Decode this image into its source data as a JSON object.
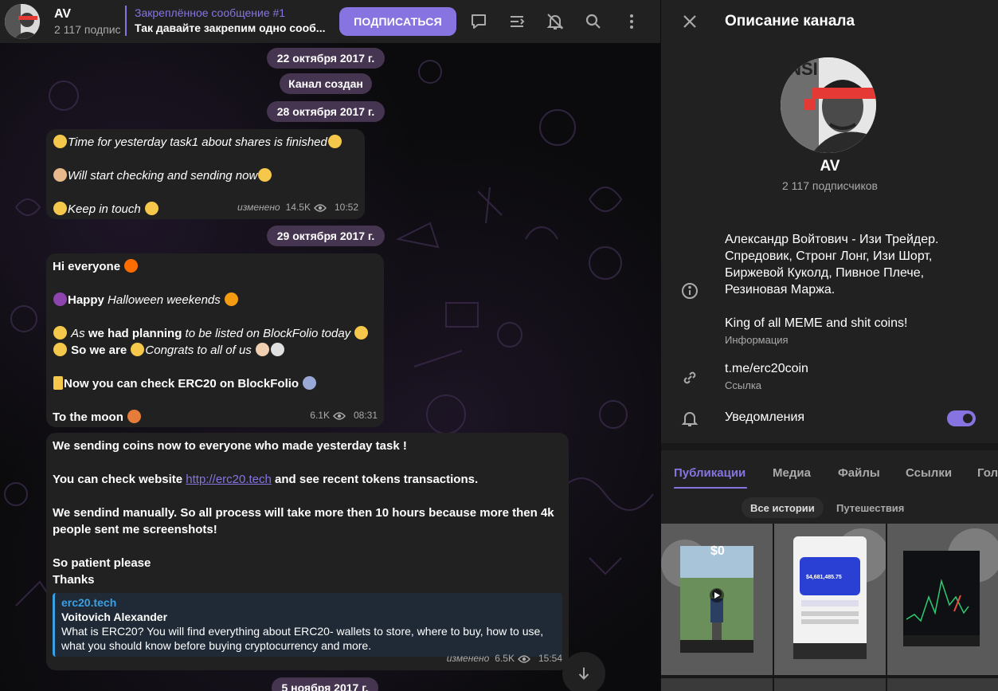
{
  "header": {
    "title": "AV",
    "subtitle": "2 117 подпис",
    "pinned_title": "Закреплённое сообщение #1",
    "pinned_text": "Так давайте закрепим одно сооб...",
    "subscribe_label": "ПОДПИСАТЬСЯ"
  },
  "chat": {
    "dates": [
      "22 октября 2017 г.",
      "28 октября 2017 г.",
      "29 октября 2017 г.",
      "5 ноября 2017 г."
    ],
    "service": "Канал создан",
    "msg1": {
      "line1": "Time for yesterday task1 about shares is finished",
      "line2": "Will start checking and sending now",
      "line3": "Keep in touch",
      "edited": "изменено",
      "views": "14.5K",
      "time": "10:52"
    },
    "msg2": {
      "l1": "Hi everyone",
      "l2a": "Happy",
      "l2b": "Halloween weekends",
      "l3a": "As",
      "l3b": "we had planning",
      "l3c": "to be listed on BlockFolio today",
      "l4a": "So we are",
      "l4b": "Congrats to all of us",
      "l5": "Now you can check ERC20 on BlockFolio",
      "l6": "To the moon",
      "views": "6.1K",
      "time": "08:31"
    },
    "msg3": {
      "p1": "We sending coins now to everyone who made yesterday task  !",
      "p2a": "You can check website ",
      "p2link": "http://erc20.tech",
      "p2b": " and see recent tokens transactions.",
      "p3": "We sendind manually. So all process will take more then 10 hours because more then 4k people sent me screenshots!",
      "p4": "So patient please",
      "p5": "Thanks",
      "preview_site": "erc20.tech",
      "preview_title": "Voitovich Alexander",
      "preview_text": "What is ERC20? You will find everything about ERC20- wallets to store, where to buy, how to use, what you should know before buying cryptocurrency and more.",
      "edited": "изменено",
      "views": "6.5K",
      "time": "15:54"
    }
  },
  "panel": {
    "title": "Описание канала",
    "name": "AV",
    "subscribers": "2 117 подписчиков",
    "desc1": "Александр Войтович - Изи Трейдер. Спредовик, Стронг Лонг, Изи Шорт, Биржевой Куколд, Пивное Плече, Резиновая Маржа.",
    "desc2": "King of all MEME and shit coins!",
    "desc_label": "Информация",
    "link": "t.me/erc20coin",
    "link_label": "Ссылка",
    "notifications": "Уведомления",
    "notifications_on": true,
    "tabs": [
      "Публикации",
      "Медиа",
      "Файлы",
      "Ссылки",
      "Гол"
    ],
    "chips": [
      "Все истории",
      "Путешествия"
    ],
    "story1_amount": "$0",
    "story2_amount": "$4,681,485.75"
  },
  "colors": {
    "accent": "#8774e1",
    "bubble": "#212121",
    "date_pill": "#463550",
    "link_preview": "#3aa0e6"
  }
}
